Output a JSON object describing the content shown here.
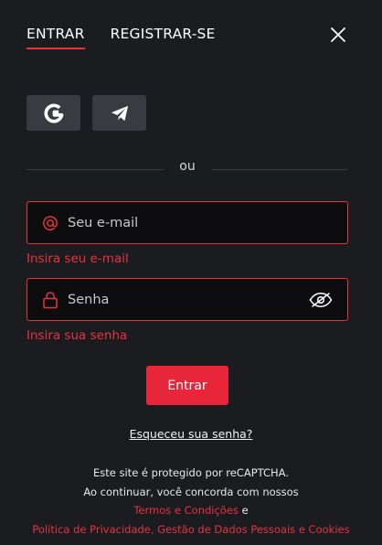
{
  "tabs": {
    "login": "ENTRAR",
    "register": "REGISTRAR-SE"
  },
  "social": {
    "google_icon": "google-icon",
    "telegram_icon": "telegram-icon"
  },
  "divider": "ou",
  "email": {
    "placeholder": "Seu e-mail",
    "value": "",
    "error": "Insira seu e-mail"
  },
  "password": {
    "placeholder": "Senha",
    "value": "",
    "error": "Insira sua senha"
  },
  "submit_label": "Entrar",
  "forgot_label": "Esqueceu sua senha?",
  "legal": {
    "line1": "Este site é protegido por reCAPTCHA.",
    "line2": "Ao continuar, você concorda com nossos",
    "terms": "Termos e Condições",
    "and": "e",
    "privacy": "Política de Privacidade, Gestão de Dados Pessoais e Cookies"
  },
  "colors": {
    "accent": "#e8333f",
    "background": "#1b1c20",
    "button": "#e8263a"
  }
}
